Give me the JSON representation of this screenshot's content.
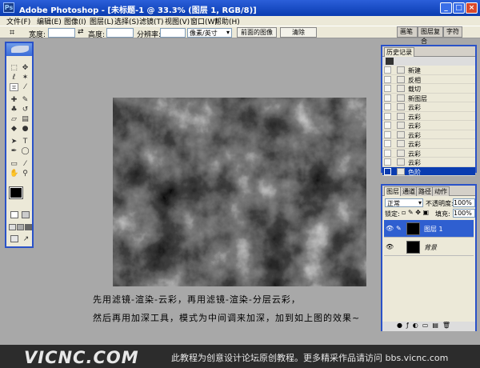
{
  "window": {
    "icon": "Ps",
    "title": "Adobe Photoshop - [未标题-1 @ 33.3% (图层 1, RGB/8)]",
    "buttons": [
      "_",
      "□",
      "×"
    ]
  },
  "menu": [
    "文件(F)",
    "编辑(E)",
    "图像(I)",
    "图层(L)",
    "选择(S)",
    "滤镜(T)",
    "视图(V)",
    "窗口(W)",
    "帮助(H)"
  ],
  "options": {
    "width_label": "宽度:",
    "height_label": "高度:",
    "resolution_label": "分辨率:",
    "unit_value": "像素/英寸",
    "front_image_button": "前面的图像",
    "clear_button": "清除"
  },
  "palette_well": {
    "tabs": [
      "画笔",
      "图层复合",
      "字符"
    ]
  },
  "history": {
    "tab": "历史记录",
    "items": [
      "新建",
      "反相",
      "载切",
      "新图层",
      "云彩",
      "云彩",
      "云彩",
      "云彩",
      "云彩",
      "云彩",
      "云彩",
      "云彩"
    ],
    "selected": "色阶"
  },
  "layers": {
    "tabs": [
      "图层",
      "通道",
      "路径",
      "动作"
    ],
    "blend_mode": "正常",
    "opacity_label": "不透明度:",
    "opacity_value": "100%",
    "lock_label": "锁定:",
    "fill_label": "填充:",
    "fill_value": "100%",
    "items": [
      {
        "name": "图层 1",
        "selected": true
      },
      {
        "name": "背景",
        "selected": false
      }
    ]
  },
  "caption": {
    "line1": "先用滤镜-渲染-云彩，再用滤镜-渲染-分层云彩，",
    "line2": "然后再用加深工具，模式为中间调来加深，加到如上图的效果~"
  },
  "footer": {
    "logo": "VICNC.COM",
    "text": "此教程为创意设计论坛原创教程。更多精采作品请访问 bbs.vicnc.com"
  }
}
